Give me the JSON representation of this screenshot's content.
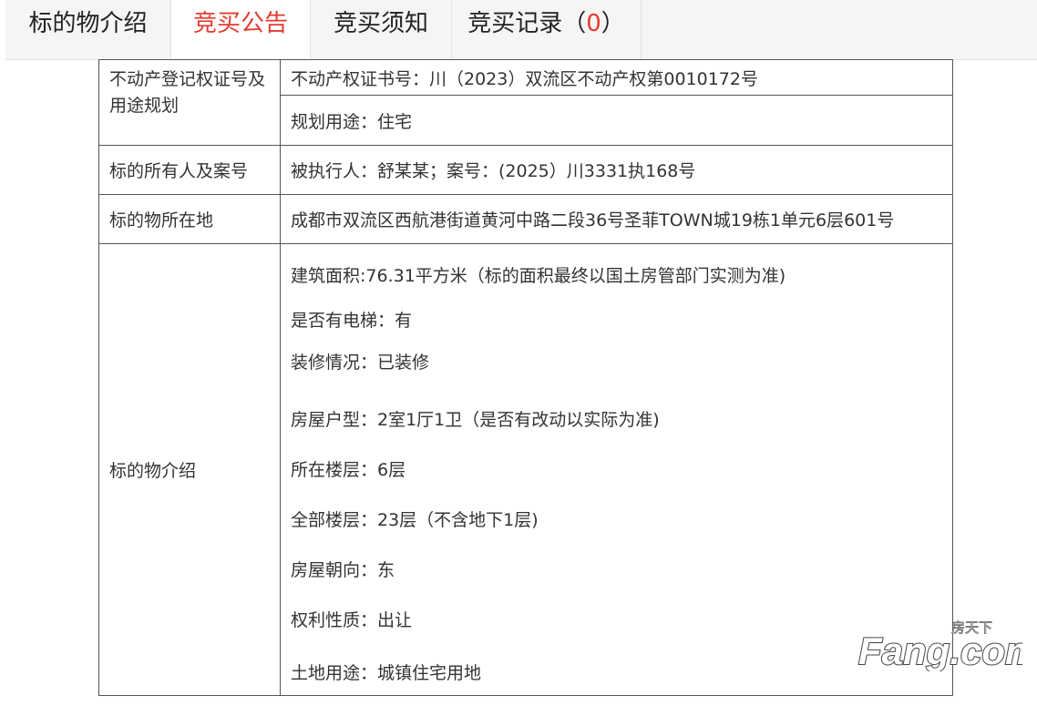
{
  "tabs": [
    {
      "label": "标的物介绍",
      "active": false
    },
    {
      "label": "竞买公告",
      "active": true
    },
    {
      "label": "竞买须知",
      "active": false
    },
    {
      "label": "竞买记录（",
      "count": "0",
      "suffix": "）",
      "active": false
    }
  ],
  "table": {
    "rows": [
      {
        "label": "不动产登记权证号及用途规划",
        "values": [
          "不动产权证书号：川（2023）双流区不动产权第0010172号",
          "规划用途：住宅"
        ]
      },
      {
        "label": "标的所有人及案号",
        "values": [
          "被执行人：舒某某；案号：(2025）川3331执168号"
        ]
      },
      {
        "label": "标的物所在地",
        "values": [
          " 成都市双流区西航港街道黄河中路二段36号圣菲TOWN城19栋1单元6层601号"
        ]
      },
      {
        "label": "标的物介绍",
        "values": [
          "建筑面积:76.31平方米（标的面积最终以国土房管部门实测为准)",
          "是否有电梯：有",
          "装修情况：已装修",
          "房屋户型：2室1厅1卫（是否有改动以实际为准)",
          "所在楼层：6层",
          "全部楼层：23层（不含地下1层)",
          "房屋朝向：东",
          "权利性质：出让",
          "土地用途：城镇住宅用地"
        ]
      }
    ]
  },
  "watermark": {
    "top_text": "房天下",
    "brand_text": "Fang.com"
  }
}
